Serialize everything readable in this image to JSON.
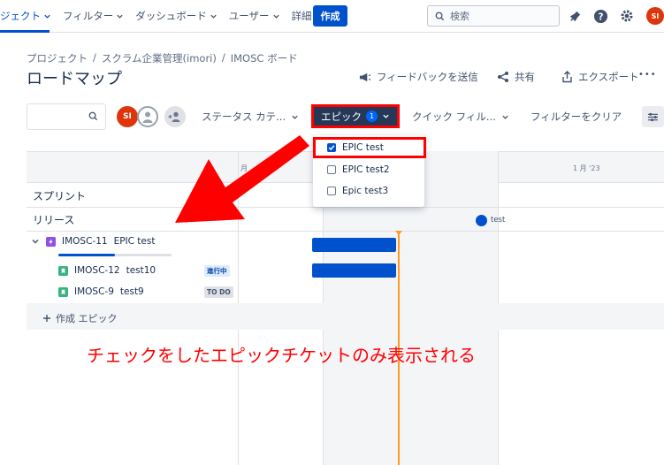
{
  "nav": {
    "items": [
      {
        "label": "ジェクト",
        "active": true
      },
      {
        "label": "フィルター",
        "active": false
      },
      {
        "label": "ダッシュボード",
        "active": false
      },
      {
        "label": "ユーザー",
        "active": false
      },
      {
        "label": "詳細",
        "active": false
      }
    ],
    "create_label": "作成",
    "search_placeholder": "検索",
    "avatar_initials": "SI",
    "accent_color": "#0052cc"
  },
  "header": {
    "breadcrumb": [
      "プロジェクト",
      "/",
      "スクラム企業管理(imori)",
      "/",
      "IMOSC ボード"
    ],
    "title": "ロードマップ",
    "feedback_label": "フィードバックを送信",
    "share_label": "共有",
    "export_label": "エクスポート",
    "more_label": "•••"
  },
  "filters": {
    "avatar_initials": "SI",
    "status_category_label": "ステータス カテ...",
    "epic_label": "エピック",
    "epic_count": "1",
    "quick_filter_label": "クイック フィル...",
    "clear_label": "フィルターをクリア"
  },
  "epic_dropdown": {
    "options": [
      {
        "label": "EPIC test",
        "checked": true
      },
      {
        "label": "EPIC test2",
        "checked": false
      },
      {
        "label": "Epic test3",
        "checked": false
      }
    ]
  },
  "roadmap": {
    "month_labels": [
      "月",
      "1 月 '23"
    ],
    "sprint_label": "スプリント",
    "release_label": "リリース",
    "release_marker": "test",
    "epic": {
      "key": "IMOSC-11",
      "summary": "EPIC test",
      "progress": 0.5
    },
    "issues": [
      {
        "key": "IMOSC-12",
        "summary": "test10",
        "status": "進行中"
      },
      {
        "key": "IMOSC-9",
        "summary": "test9",
        "status": "TO DO"
      }
    ],
    "add_epic_label": "作成 エピック"
  },
  "annotation": {
    "text": "チェックをしたエピックチケットのみ表示される",
    "color": "#ff0000"
  }
}
